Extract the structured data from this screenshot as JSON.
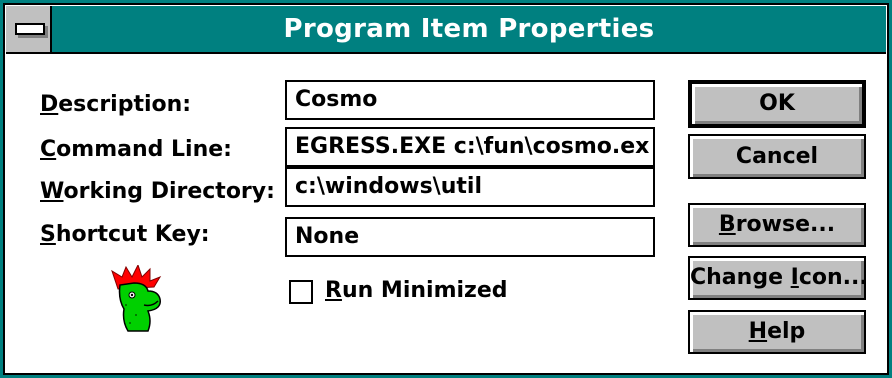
{
  "window": {
    "title": "Program Item Properties"
  },
  "labels": {
    "description": {
      "accel": "D",
      "rest": "escription:"
    },
    "command_line": {
      "accel": "C",
      "rest": "ommand Line:"
    },
    "working_directory": {
      "accel": "W",
      "rest": "orking Directory:"
    },
    "shortcut_key": {
      "accel": "S",
      "rest": "hortcut Key:"
    }
  },
  "fields": {
    "description": "Cosmo",
    "command_line": "EGRESS.EXE c:\\fun\\cosmo.ex",
    "working_directory": "c:\\windows\\util",
    "shortcut_key": "None"
  },
  "checkbox": {
    "accel": "R",
    "rest": "un Minimized",
    "checked": false
  },
  "buttons": {
    "ok": "OK",
    "cancel": "Cancel",
    "browse": {
      "accel": "B",
      "rest": "rowse..."
    },
    "change_icon": {
      "pre": "Change ",
      "accel": "I",
      "rest": "con..."
    },
    "help": {
      "accel": "H",
      "rest": "elp"
    }
  },
  "icon_name": "cosmo-icon",
  "colors": {
    "titlebar": "#008080",
    "button_face": "#c0c0c0",
    "window_bg": "#ffffff"
  }
}
